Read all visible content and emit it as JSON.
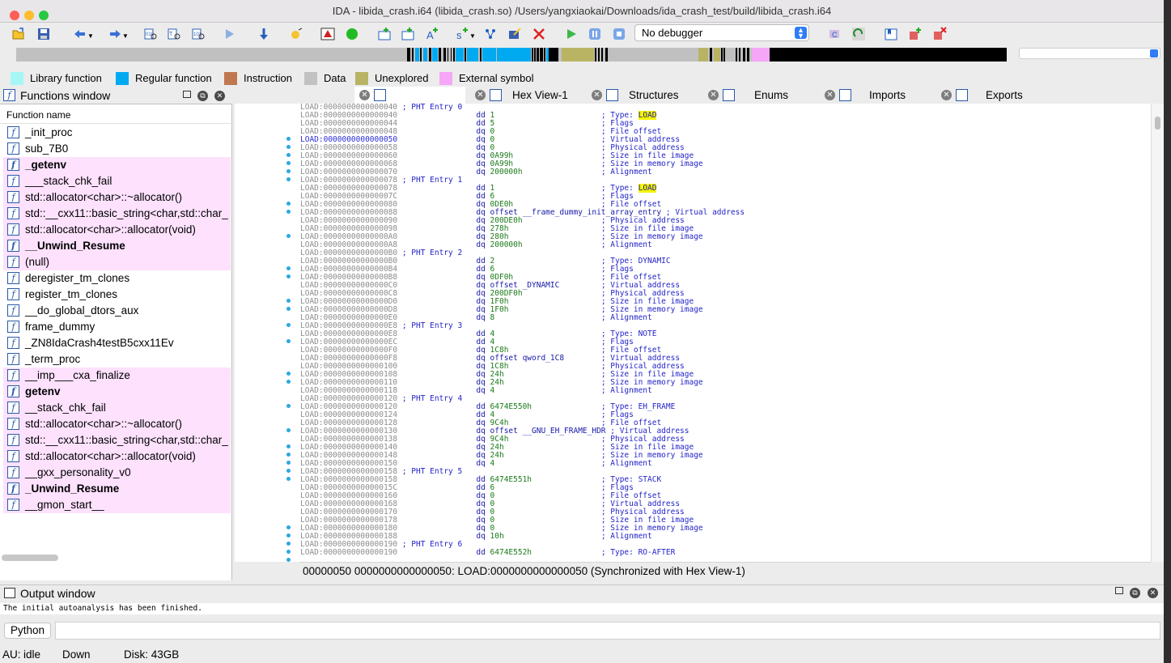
{
  "window": {
    "title": "IDA - libida_crash.i64 (libida_crash.so) /Users/yangxiaokai/Downloads/ida_crash_test/build/libida_crash.i64"
  },
  "toolbar": {
    "debugger_select": "No debugger"
  },
  "legend": [
    {
      "label": "Library function",
      "color": "#a6f6f6"
    },
    {
      "label": "Regular function",
      "color": "#00aaf0"
    },
    {
      "label": "Instruction",
      "color": "#c07850"
    },
    {
      "label": "Data",
      "color": "#c2c2c2"
    },
    {
      "label": "Unexplored",
      "color": "#b8b464"
    },
    {
      "label": "External symbol",
      "color": "#f6a6f6"
    }
  ],
  "functions_window": {
    "title": "Functions window",
    "column": "Function name",
    "items": [
      {
        "name": "_init_proc",
        "ext": false,
        "bold": false
      },
      {
        "name": "sub_7B0",
        "ext": false,
        "bold": false
      },
      {
        "name": "_getenv",
        "ext": true,
        "bold": true
      },
      {
        "name": "___stack_chk_fail",
        "ext": true,
        "bold": false
      },
      {
        "name": "std::allocator<char>::~allocator()",
        "ext": true,
        "bold": false
      },
      {
        "name": "std::__cxx11::basic_string<char,std::char_",
        "ext": true,
        "bold": false
      },
      {
        "name": "std::allocator<char>::allocator(void)",
        "ext": true,
        "bold": false
      },
      {
        "name": "__Unwind_Resume",
        "ext": true,
        "bold": true
      },
      {
        "name": "(null)",
        "ext": true,
        "bold": false
      },
      {
        "name": "deregister_tm_clones",
        "ext": false,
        "bold": false
      },
      {
        "name": "register_tm_clones",
        "ext": false,
        "bold": false
      },
      {
        "name": "__do_global_dtors_aux",
        "ext": false,
        "bold": false
      },
      {
        "name": "frame_dummy",
        "ext": false,
        "bold": false
      },
      {
        "name": "_ZN8IdaCrash4testB5cxx11Ev",
        "ext": false,
        "bold": false
      },
      {
        "name": "_term_proc",
        "ext": false,
        "bold": false
      },
      {
        "name": "__imp___cxa_finalize",
        "ext": true,
        "bold": false
      },
      {
        "name": "getenv",
        "ext": true,
        "bold": true
      },
      {
        "name": "__stack_chk_fail",
        "ext": true,
        "bold": false
      },
      {
        "name": "std::allocator<char>::~allocator()",
        "ext": true,
        "bold": false
      },
      {
        "name": "std::__cxx11::basic_string<char,std::char_",
        "ext": true,
        "bold": false
      },
      {
        "name": "std::allocator<char>::allocator(void)",
        "ext": true,
        "bold": false
      },
      {
        "name": "__gxx_personality_v0",
        "ext": true,
        "bold": false
      },
      {
        "name": "_Unwind_Resume",
        "ext": true,
        "bold": true
      },
      {
        "name": "__gmon_start__",
        "ext": true,
        "bold": false
      }
    ]
  },
  "tabs": [
    "Hex View-1",
    "Structures",
    "Enums",
    "Imports",
    "Exports"
  ],
  "listing": [
    {
      "a": "LOAD:0000000000000040",
      "i": "",
      "o": "",
      "c": "; PHT Entry 0",
      "h": false,
      "cur": false
    },
    {
      "a": "LOAD:0000000000000040",
      "i": "dd",
      "o": "1",
      "c": "; Type: LOAD",
      "h": true,
      "cur": false
    },
    {
      "a": "LOAD:0000000000000044",
      "i": "dd",
      "o": "5",
      "c": "; Flags",
      "h": false,
      "cur": false
    },
    {
      "a": "LOAD:0000000000000048",
      "i": "dq",
      "o": "0",
      "c": "; File offset",
      "h": false,
      "cur": false
    },
    {
      "a": "LOAD:0000000000000050",
      "i": "dq",
      "o": "0",
      "c": "; Virtual address",
      "h": false,
      "cur": true
    },
    {
      "a": "LOAD:0000000000000058",
      "i": "dq",
      "o": "0",
      "c": "; Physical address",
      "h": false,
      "cur": false
    },
    {
      "a": "LOAD:0000000000000060",
      "i": "dq",
      "o": "0A99h",
      "c": "; Size in file image",
      "h": false,
      "cur": false
    },
    {
      "a": "LOAD:0000000000000068",
      "i": "dq",
      "o": "0A99h",
      "c": "; Size in memory image",
      "h": false,
      "cur": false
    },
    {
      "a": "LOAD:0000000000000070",
      "i": "dq",
      "o": "200000h",
      "c": "; Alignment",
      "h": false,
      "cur": false
    },
    {
      "a": "LOAD:0000000000000078",
      "i": "",
      "o": "",
      "c": "; PHT Entry 1",
      "h": false,
      "cur": false
    },
    {
      "a": "LOAD:0000000000000078",
      "i": "dd",
      "o": "1",
      "c": "; Type: LOAD",
      "h": true,
      "cur": false
    },
    {
      "a": "LOAD:000000000000007C",
      "i": "dd",
      "o": "6",
      "c": "; Flags",
      "h": false,
      "cur": false
    },
    {
      "a": "LOAD:0000000000000080",
      "i": "dq",
      "o": "0DE0h",
      "c": "; File offset",
      "h": false,
      "cur": false
    },
    {
      "a": "LOAD:0000000000000088",
      "i": "dq",
      "o": "offset __frame_dummy_init_array_entry",
      "c": "; Virtual address",
      "h": false,
      "cur": false
    },
    {
      "a": "LOAD:0000000000000090",
      "i": "dq",
      "o": "200DE0h",
      "c": "; Physical address",
      "h": false,
      "cur": false
    },
    {
      "a": "LOAD:0000000000000098",
      "i": "dq",
      "o": "278h",
      "c": "; Size in file image",
      "h": false,
      "cur": false
    },
    {
      "a": "LOAD:00000000000000A0",
      "i": "dq",
      "o": "280h",
      "c": "; Size in memory image",
      "h": false,
      "cur": false
    },
    {
      "a": "LOAD:00000000000000A8",
      "i": "dq",
      "o": "200000h",
      "c": "; Alignment",
      "h": false,
      "cur": false
    },
    {
      "a": "LOAD:00000000000000B0",
      "i": "",
      "o": "",
      "c": "; PHT Entry 2",
      "h": false,
      "cur": false
    },
    {
      "a": "LOAD:00000000000000B0",
      "i": "dd",
      "o": "2",
      "c": "; Type: DYNAMIC",
      "h": false,
      "cur": false
    },
    {
      "a": "LOAD:00000000000000B4",
      "i": "dd",
      "o": "6",
      "c": "; Flags",
      "h": false,
      "cur": false
    },
    {
      "a": "LOAD:00000000000000B8",
      "i": "dq",
      "o": "0DF0h",
      "c": "; File offset",
      "h": false,
      "cur": false
    },
    {
      "a": "LOAD:00000000000000C0",
      "i": "dq",
      "o": "offset _DYNAMIC",
      "c": "; Virtual address",
      "h": false,
      "cur": false
    },
    {
      "a": "LOAD:00000000000000C8",
      "i": "dq",
      "o": "200DF0h",
      "c": "; Physical address",
      "h": false,
      "cur": false
    },
    {
      "a": "LOAD:00000000000000D0",
      "i": "dq",
      "o": "1F0h",
      "c": "; Size in file image",
      "h": false,
      "cur": false
    },
    {
      "a": "LOAD:00000000000000D8",
      "i": "dq",
      "o": "1F0h",
      "c": "; Size in memory image",
      "h": false,
      "cur": false
    },
    {
      "a": "LOAD:00000000000000E0",
      "i": "dq",
      "o": "8",
      "c": "; Alignment",
      "h": false,
      "cur": false
    },
    {
      "a": "LOAD:00000000000000E8",
      "i": "",
      "o": "",
      "c": "; PHT Entry 3",
      "h": false,
      "cur": false
    },
    {
      "a": "LOAD:00000000000000E8",
      "i": "dd",
      "o": "4",
      "c": "; Type: NOTE",
      "h": false,
      "cur": false
    },
    {
      "a": "LOAD:00000000000000EC",
      "i": "dd",
      "o": "4",
      "c": "; Flags",
      "h": false,
      "cur": false
    },
    {
      "a": "LOAD:00000000000000F0",
      "i": "dq",
      "o": "1C8h",
      "c": "; File offset",
      "h": false,
      "cur": false
    },
    {
      "a": "LOAD:00000000000000F8",
      "i": "dq",
      "o": "offset qword_1C8",
      "c": "; Virtual address",
      "h": false,
      "cur": false
    },
    {
      "a": "LOAD:0000000000000100",
      "i": "dq",
      "o": "1C8h",
      "c": "; Physical address",
      "h": false,
      "cur": false
    },
    {
      "a": "LOAD:0000000000000108",
      "i": "dq",
      "o": "24h",
      "c": "; Size in file image",
      "h": false,
      "cur": false
    },
    {
      "a": "LOAD:0000000000000110",
      "i": "dq",
      "o": "24h",
      "c": "; Size in memory image",
      "h": false,
      "cur": false
    },
    {
      "a": "LOAD:0000000000000118",
      "i": "dq",
      "o": "4",
      "c": "; Alignment",
      "h": false,
      "cur": false
    },
    {
      "a": "LOAD:0000000000000120",
      "i": "",
      "o": "",
      "c": "; PHT Entry 4",
      "h": false,
      "cur": false
    },
    {
      "a": "LOAD:0000000000000120",
      "i": "dd",
      "o": "6474E550h",
      "c": "; Type: EH_FRAME",
      "h": false,
      "cur": false
    },
    {
      "a": "LOAD:0000000000000124",
      "i": "dd",
      "o": "4",
      "c": "; Flags",
      "h": false,
      "cur": false
    },
    {
      "a": "LOAD:0000000000000128",
      "i": "dq",
      "o": "9C4h",
      "c": "; File offset",
      "h": false,
      "cur": false
    },
    {
      "a": "LOAD:0000000000000130",
      "i": "dq",
      "o": "offset __GNU_EH_FRAME_HDR",
      "c": "; Virtual address",
      "h": false,
      "cur": false
    },
    {
      "a": "LOAD:0000000000000138",
      "i": "dq",
      "o": "9C4h",
      "c": "; Physical address",
      "h": false,
      "cur": false
    },
    {
      "a": "LOAD:0000000000000140",
      "i": "dq",
      "o": "24h",
      "c": "; Size in file image",
      "h": false,
      "cur": false
    },
    {
      "a": "LOAD:0000000000000148",
      "i": "dq",
      "o": "24h",
      "c": "; Size in memory image",
      "h": false,
      "cur": false
    },
    {
      "a": "LOAD:0000000000000150",
      "i": "dq",
      "o": "4",
      "c": "; Alignment",
      "h": false,
      "cur": false
    },
    {
      "a": "LOAD:0000000000000158",
      "i": "",
      "o": "",
      "c": "; PHT Entry 5",
      "h": false,
      "cur": false
    },
    {
      "a": "LOAD:0000000000000158",
      "i": "dd",
      "o": "6474E551h",
      "c": "; Type: STACK",
      "h": false,
      "cur": false
    },
    {
      "a": "LOAD:000000000000015C",
      "i": "dd",
      "o": "6",
      "c": "; Flags",
      "h": false,
      "cur": false
    },
    {
      "a": "LOAD:0000000000000160",
      "i": "dq",
      "o": "0",
      "c": "; File offset",
      "h": false,
      "cur": false
    },
    {
      "a": "LOAD:0000000000000168",
      "i": "dq",
      "o": "0",
      "c": "; Virtual address",
      "h": false,
      "cur": false
    },
    {
      "a": "LOAD:0000000000000170",
      "i": "dq",
      "o": "0",
      "c": "; Physical address",
      "h": false,
      "cur": false
    },
    {
      "a": "LOAD:0000000000000178",
      "i": "dq",
      "o": "0",
      "c": "; Size in file image",
      "h": false,
      "cur": false
    },
    {
      "a": "LOAD:0000000000000180",
      "i": "dq",
      "o": "0",
      "c": "; Size in memory image",
      "h": false,
      "cur": false
    },
    {
      "a": "LOAD:0000000000000188",
      "i": "dq",
      "o": "10h",
      "c": "; Alignment",
      "h": false,
      "cur": false
    },
    {
      "a": "LOAD:0000000000000190",
      "i": "",
      "o": "",
      "c": "; PHT Entry 6",
      "h": false,
      "cur": false
    },
    {
      "a": "LOAD:0000000000000190",
      "i": "dd",
      "o": "6474E552h",
      "c": "; Type: RO-AFTER",
      "h": false,
      "cur": false
    }
  ],
  "status_line": "00000050  0000000000000050: LOAD:0000000000000050  (Synchronized with Hex View-1)",
  "output": {
    "title": "Output window",
    "text": "The initial autoanalysis has been finished.",
    "python_btn": "Python"
  },
  "statusbar": {
    "au": "AU:",
    "state": "idle",
    "direction": "Down",
    "disk": "Disk: 43GB"
  }
}
